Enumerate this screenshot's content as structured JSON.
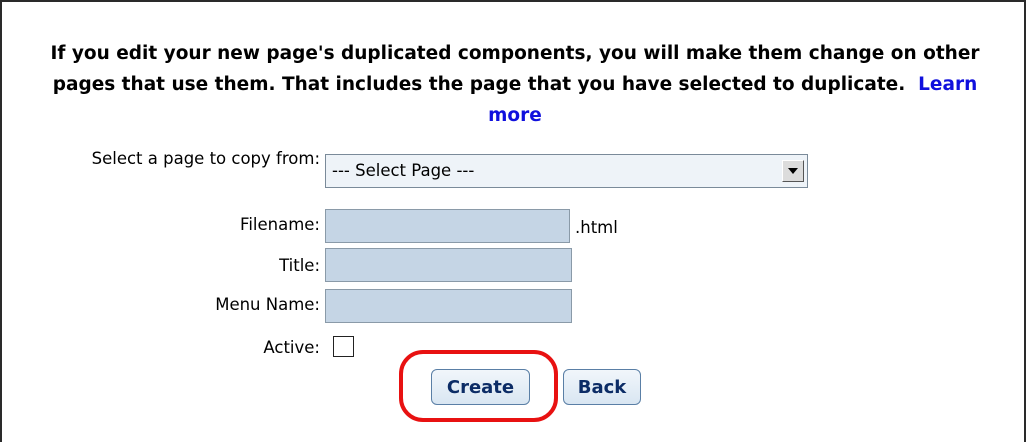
{
  "warning": {
    "text": "If you edit your new page's duplicated components, you will make them change on other pages that use them. That includes the page that you have selected to duplicate.",
    "link_label": "Learn more"
  },
  "form": {
    "select_label": "Select a page to copy from:",
    "select_value": "--- Select Page ---",
    "filename_label": "Filename:",
    "filename_suffix": ".html",
    "filename_value": "",
    "title_label": "Title:",
    "title_value": "",
    "menu_name_label": "Menu Name:",
    "menu_name_value": "",
    "active_label": "Active:",
    "active_checked": false
  },
  "buttons": {
    "create_label": "Create",
    "back_label": "Back"
  },
  "colors": {
    "link": "#1010dd",
    "input_bg": "#c5d5e5",
    "highlight": "#e81111"
  }
}
